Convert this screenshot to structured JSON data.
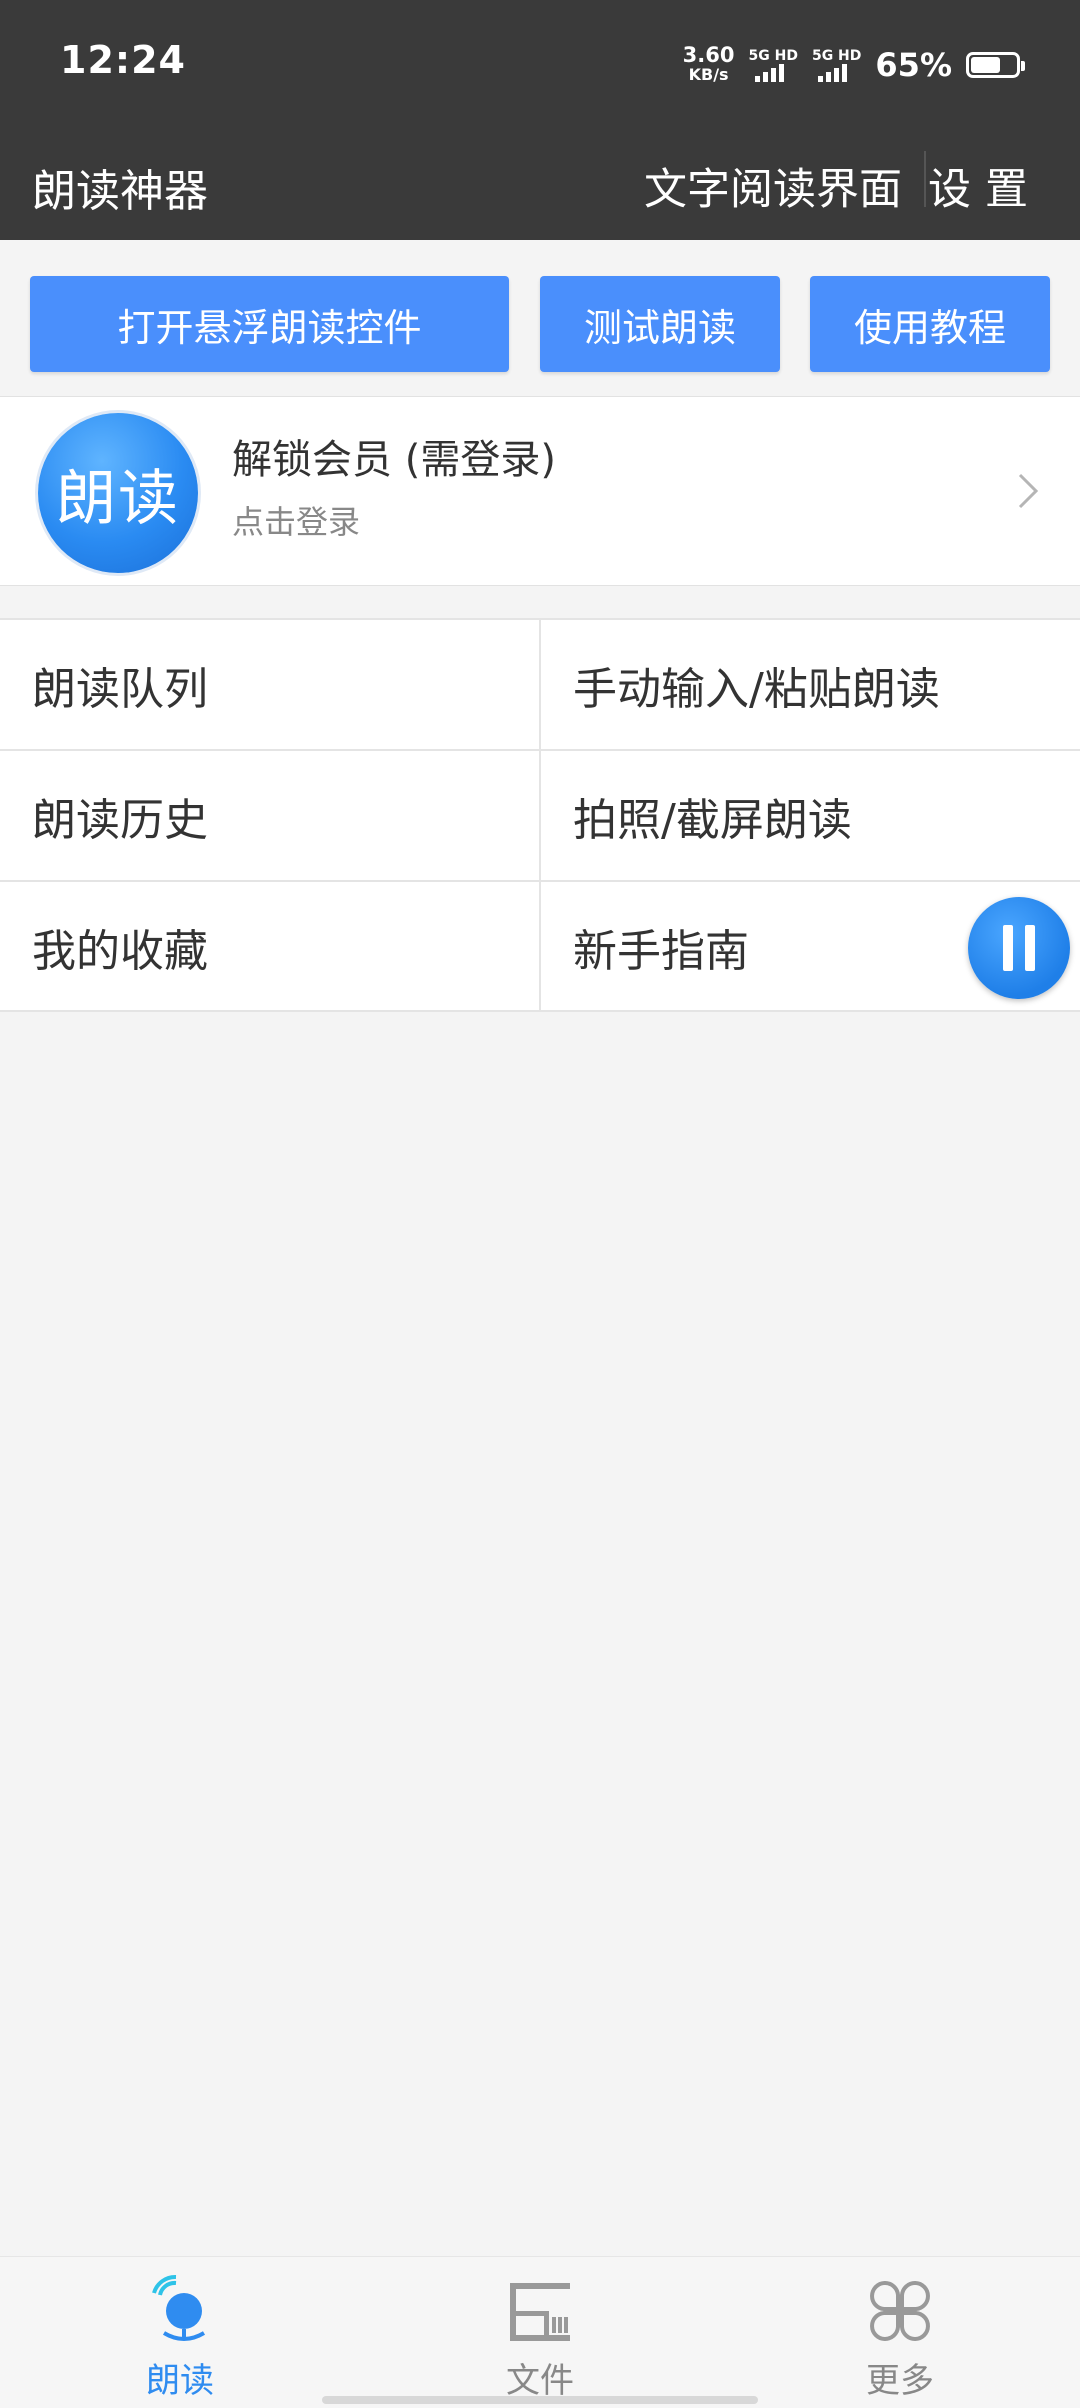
{
  "status_bar": {
    "time": "12:24",
    "net_speed_value": "3.60",
    "net_speed_unit": "KB/s",
    "sim1_label": "5G HD",
    "sim2_label": "5G HD",
    "battery_percent": "65%",
    "battery_level": 0.65
  },
  "app_bar": {
    "title": "朗读神器",
    "reader_label": "文字阅读界面",
    "settings_label": "设置"
  },
  "actions": {
    "float_label": "打开悬浮朗读控件",
    "test_label": "测试朗读",
    "tutorial_label": "使用教程"
  },
  "member": {
    "logo_text": "朗读",
    "title": "解锁会员 (需登录)",
    "subtitle": "点击登录"
  },
  "menu": {
    "items": [
      {
        "label": "朗读队列"
      },
      {
        "label": "手动输入/粘贴朗读"
      },
      {
        "label": "朗读历史"
      },
      {
        "label": "拍照/截屏朗读"
      },
      {
        "label": "我的收藏"
      },
      {
        "label": "新手指南"
      }
    ]
  },
  "bottom_nav": {
    "items": [
      {
        "label": "朗读",
        "icon": "read-icon",
        "active": true
      },
      {
        "label": "文件",
        "icon": "file-icon",
        "active": false
      },
      {
        "label": "更多",
        "icon": "more-icon",
        "active": false
      }
    ]
  },
  "colors": {
    "accent": "#4a8ffc",
    "bar_bg": "#3a3a3a",
    "active_tab": "#2f8cf0"
  }
}
